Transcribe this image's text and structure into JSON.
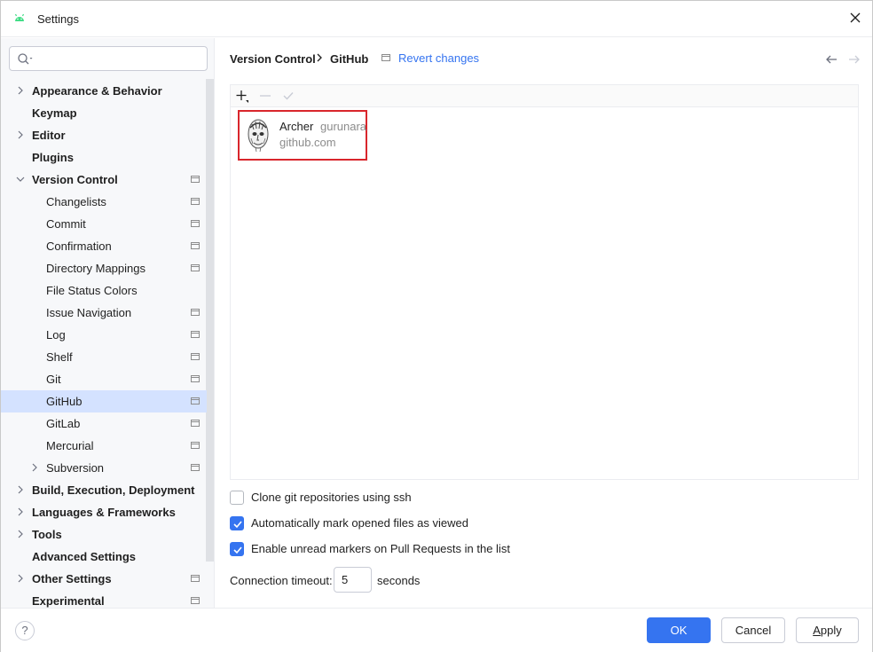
{
  "window": {
    "title": "Settings",
    "app_icon": "android-icon",
    "close_icon": "close-icon"
  },
  "sidebar": {
    "search": {
      "placeholder": "",
      "value": ""
    },
    "items": [
      {
        "label": "Appearance & Behavior",
        "level": 0,
        "bold": true,
        "expandable": true,
        "expanded": false,
        "project_scoped": false
      },
      {
        "label": "Keymap",
        "level": 0,
        "bold": true,
        "expandable": false,
        "project_scoped": false
      },
      {
        "label": "Editor",
        "level": 0,
        "bold": true,
        "expandable": true,
        "expanded": false,
        "project_scoped": false
      },
      {
        "label": "Plugins",
        "level": 0,
        "bold": true,
        "expandable": false,
        "project_scoped": false
      },
      {
        "label": "Version Control",
        "level": 0,
        "bold": true,
        "expandable": true,
        "expanded": true,
        "project_scoped": true
      },
      {
        "label": "Changelists",
        "level": 1,
        "bold": false,
        "project_scoped": true
      },
      {
        "label": "Commit",
        "level": 1,
        "bold": false,
        "project_scoped": true
      },
      {
        "label": "Confirmation",
        "level": 1,
        "bold": false,
        "project_scoped": true
      },
      {
        "label": "Directory Mappings",
        "level": 1,
        "bold": false,
        "project_scoped": true
      },
      {
        "label": "File Status Colors",
        "level": 1,
        "bold": false,
        "project_scoped": false
      },
      {
        "label": "Issue Navigation",
        "level": 1,
        "bold": false,
        "project_scoped": true
      },
      {
        "label": "Log",
        "level": 1,
        "bold": false,
        "project_scoped": true
      },
      {
        "label": "Shelf",
        "level": 1,
        "bold": false,
        "project_scoped": true
      },
      {
        "label": "Git",
        "level": 1,
        "bold": false,
        "project_scoped": true
      },
      {
        "label": "GitHub",
        "level": 1,
        "bold": false,
        "project_scoped": true,
        "selected": true
      },
      {
        "label": "GitLab",
        "level": 1,
        "bold": false,
        "project_scoped": true
      },
      {
        "label": "Mercurial",
        "level": 1,
        "bold": false,
        "project_scoped": true
      },
      {
        "label": "Subversion",
        "level": 1,
        "bold": false,
        "expandable": true,
        "expanded": false,
        "project_scoped": true
      },
      {
        "label": "Build, Execution, Deployment",
        "level": 0,
        "bold": true,
        "expandable": true,
        "expanded": false,
        "project_scoped": false
      },
      {
        "label": "Languages & Frameworks",
        "level": 0,
        "bold": true,
        "expandable": true,
        "expanded": false,
        "project_scoped": false
      },
      {
        "label": "Tools",
        "level": 0,
        "bold": true,
        "expandable": true,
        "expanded": false,
        "project_scoped": false
      },
      {
        "label": "Advanced Settings",
        "level": 0,
        "bold": true,
        "expandable": false,
        "project_scoped": false
      },
      {
        "label": "Other Settings",
        "level": 0,
        "bold": true,
        "expandable": true,
        "expanded": false,
        "project_scoped": true
      },
      {
        "label": "Experimental",
        "level": 0,
        "bold": true,
        "expandable": false,
        "project_scoped": true
      }
    ]
  },
  "header": {
    "breadcrumb": [
      "Version Control",
      "GitHub"
    ],
    "revert_label": "Revert changes"
  },
  "accounts": {
    "toolbar": [
      "add-icon",
      "remove-icon",
      "set-default-icon"
    ],
    "list": [
      {
        "name": "Archer",
        "login": "gurunara",
        "server": "github.com"
      }
    ]
  },
  "options": [
    {
      "label": "Clone git repositories using ssh",
      "checked": false
    },
    {
      "label": "Automatically mark opened files as viewed",
      "checked": true
    },
    {
      "label": "Enable unread markers on Pull Requests in the list",
      "checked": true
    }
  ],
  "timeout": {
    "label": "Connection timeout:",
    "value": "5",
    "unit": "seconds"
  },
  "footer": {
    "help": "?",
    "ok": "OK",
    "cancel": "Cancel",
    "apply_underlined": "A",
    "apply_rest": "pply"
  },
  "colors": {
    "accent": "#3574f0",
    "selection": "#d4e2ff",
    "highlight_border": "#d9262c"
  }
}
